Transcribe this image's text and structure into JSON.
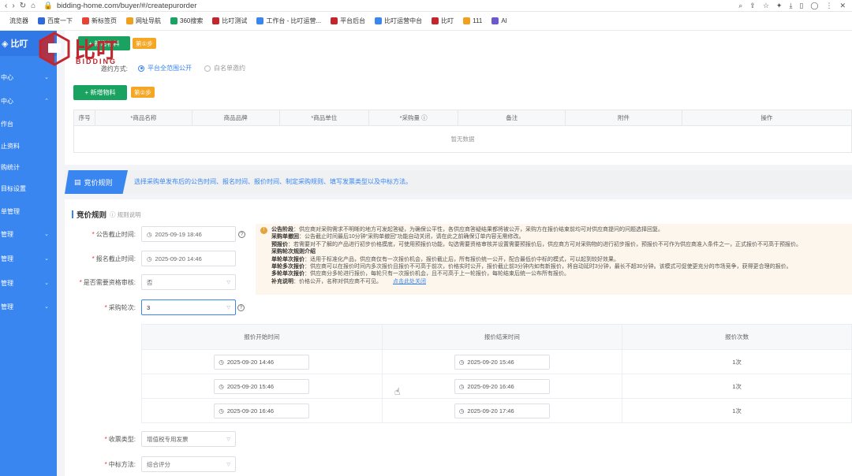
{
  "browser": {
    "url": "bidding-home.com/buyer/#/createpurorder",
    "bookmarks": [
      {
        "label": "流览器",
        "color": "#ffffff"
      },
      {
        "label": "百度一下",
        "color": "#2f6bd8"
      },
      {
        "label": "新标签页",
        "color": "#e94235"
      },
      {
        "label": "网址导航",
        "color": "#f0a020"
      },
      {
        "label": "360搜索",
        "color": "#1aa260"
      },
      {
        "label": "比叮测试",
        "color": "#c2272d"
      },
      {
        "label": "工作台 - 比叮运营...",
        "color": "#3a86f0"
      },
      {
        "label": "平台后台",
        "color": "#c2272d"
      },
      {
        "label": "比叮运营中台",
        "color": "#3a86f0"
      },
      {
        "label": "比叮",
        "color": "#c2272d"
      },
      {
        "label": "111",
        "color": "#f0a020"
      },
      {
        "label": "AI",
        "color": "#6a5acd"
      }
    ]
  },
  "brand": {
    "cn": "比叮",
    "en": "BIDDING",
    "sidebar_logo": "比叮"
  },
  "sidebar": {
    "items": [
      {
        "label": "中心",
        "chev": "⌄"
      },
      {
        "label": "中心",
        "chev": "⌃"
      },
      {
        "label": "作台",
        "chev": ""
      },
      {
        "label": "止资料",
        "chev": ""
      },
      {
        "label": "购统计",
        "chev": ""
      },
      {
        "label": "目标设置",
        "chev": ""
      },
      {
        "label": "单管理",
        "chev": ""
      },
      {
        "label": "管理",
        "chev": "⌄"
      },
      {
        "label": "管理",
        "chev": "⌄"
      },
      {
        "label": "管理",
        "chev": "⌄"
      },
      {
        "label": "管理",
        "chev": "⌄"
      }
    ]
  },
  "step1": {
    "button": "+ 新增物料",
    "badge": "第①步"
  },
  "invite": {
    "label": "邀约方式:",
    "options": [
      {
        "label": "平台全范围公开",
        "checked": true
      },
      {
        "label": "白名单邀约",
        "checked": false
      }
    ]
  },
  "step2": {
    "button": "+ 新增物料",
    "badge": "第②步"
  },
  "material_table": {
    "headers": [
      "序号",
      "*商品名称",
      "商品品牌",
      "*商品单位",
      "*采购量 ⓘ",
      "备注",
      "附件",
      "操作"
    ],
    "empty": "暂无数据"
  },
  "rules_banner": {
    "tag": "竞价规则",
    "desc": "选择采购单发布后的公告时间、报名时间、报价时间、制定采购规则、填写发票类型以及中标方法。"
  },
  "rules": {
    "title": "竞价规则",
    "subtitle": "规则说明",
    "announce_label": "公告截止时间:",
    "announce_value": "2025-09-19 18:46",
    "signup_label": "报名截止时间:",
    "signup_value": "2025-09-20 14:46",
    "deposit_label": "是否需要资格审核:",
    "deposit_value": "否",
    "rounds_label": "采购轮次:",
    "rounds_value": "3",
    "invoice_label": "收票类型:",
    "invoice_value": "增值税专用发票",
    "award_label": "中标方法:",
    "award_value": "综合评分"
  },
  "notice": {
    "lines": [
      {
        "bold": "公告阶段",
        "text": "：供应商对采购需求不明晰的地方可发起答疑，为确保公平性，各供应商答疑结果都将被公开，采购方在报价结束前均可对供应商提问的问题选择回复。"
      },
      {
        "bold": "采购单撤回",
        "text": "：公告截止时间最后10分钟“采购单撤回”功能自动关闭，请在此之前确保订单内容无需修改。"
      },
      {
        "bold": "预报价",
        "text": "：若需要对不了解的产品进行初步价格摸底，可使用预报价功能，勾选需要资格审核并设置需要预报价后，供应商方可对采购物的进行初步报价，预报价不可作为供应商准入条件之一，正式报价不可高于预报价。"
      },
      {
        "bold": "采购轮次规则介绍",
        "text": ""
      },
      {
        "bold": "单轮单次报价",
        "text": "：适用于标准化产品，供应商仅有一次报价机会，报价截止后，所有报价统一公开，配合最低价中标的模式，可以起到较好效果。"
      },
      {
        "bold": "单轮多次报价",
        "text": "：供应商可以在报价时间内多次报价且报价不可高于前次，价格实时公开，报价截止前3分钟内如有新报价，将自动延时3分钟，最长不超30分钟。该模式可促使更充分的市场竞争，获得更合理的报价。"
      },
      {
        "bold": "多轮单次报价",
        "text": "：供应商分多轮进行报价，每轮只有一次报价机会，且不可高于上一轮报价，每轮结束后统一公布所有报价。"
      },
      {
        "bold": "补充说明",
        "text": "：价格公开，名称对供应商不可见。"
      }
    ],
    "link": "点击此处关闭"
  },
  "rounds_table": {
    "headers": [
      "报价开始时间",
      "报价结束时间",
      "报价次数"
    ],
    "rows": [
      {
        "start": "2025-09-20 14:46",
        "end": "2025-09-20 15:46",
        "count": "1次"
      },
      {
        "start": "2025-09-20 15:46",
        "end": "2025-09-20 16:46",
        "count": "1次"
      },
      {
        "start": "2025-09-20 16:46",
        "end": "2025-09-20 17:46",
        "count": "1次"
      }
    ]
  },
  "colors": {
    "primary": "#3a86f0",
    "green": "#1aa260",
    "orange": "#f5a623",
    "brand_red": "#c2272d"
  }
}
